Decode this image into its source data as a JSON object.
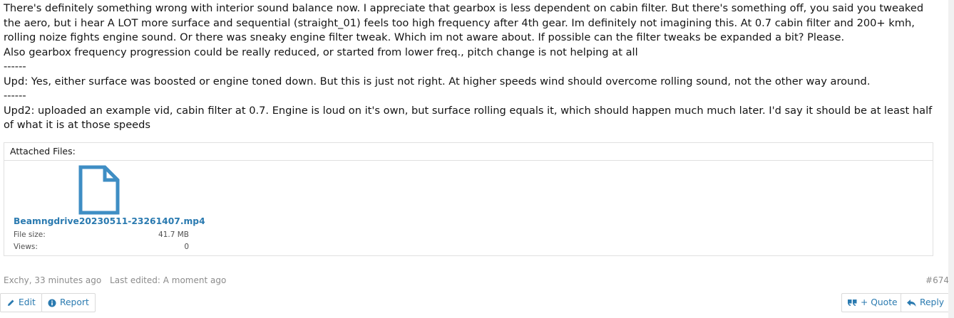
{
  "post": {
    "paragraphs": [
      "There's definitely something wrong with interior sound balance now. I appreciate that gearbox is less dependent on cabin filter. But there's something off, you said you tweaked the aero, but i hear A LOT more surface and sequential (straight_01) feels too high frequency after 4th gear. Im definitely not imagining this. At 0.7 cabin filter and 200+ kmh, rolling noize fights engine sound. Or there was sneaky engine filter tweak. Which im not aware about. If possible can the filter tweaks be expanded a bit? Please.",
      "Also gearbox frequency progression could be really reduced, or started from lower freq., pitch change is not helping at all",
      "------",
      "Upd: Yes, either surface was boosted or engine toned down. But this is just not right. At higher speeds wind should overcome rolling sound, not the other way around.",
      "------",
      "Upd2: uploaded an example vid, cabin filter at 0.7. Engine is loud on it's own, but surface rolling equals it, which should happen much much later. I'd say it should be at least half of what it is at those speeds"
    ]
  },
  "attachments": {
    "header": "Attached Files:",
    "file": {
      "name": "Beamngdrive20230511-23261407.mp4",
      "size_label": "File size:",
      "size_value": "41.7 MB",
      "views_label": "Views:",
      "views_value": "0",
      "icon": "file-icon",
      "icon_color": "#3f8ec4"
    }
  },
  "footer": {
    "author_time": "Exchy, 33 minutes ago",
    "edited": "Last edited: A moment ago",
    "permalink": "#674"
  },
  "actions": {
    "edit": "Edit",
    "report": "Report",
    "quote": "+ Quote",
    "reply": "Reply"
  },
  "colors": {
    "link": "#2a7ab0",
    "muted": "#8c8c8c",
    "border": "#e0e0e0"
  }
}
